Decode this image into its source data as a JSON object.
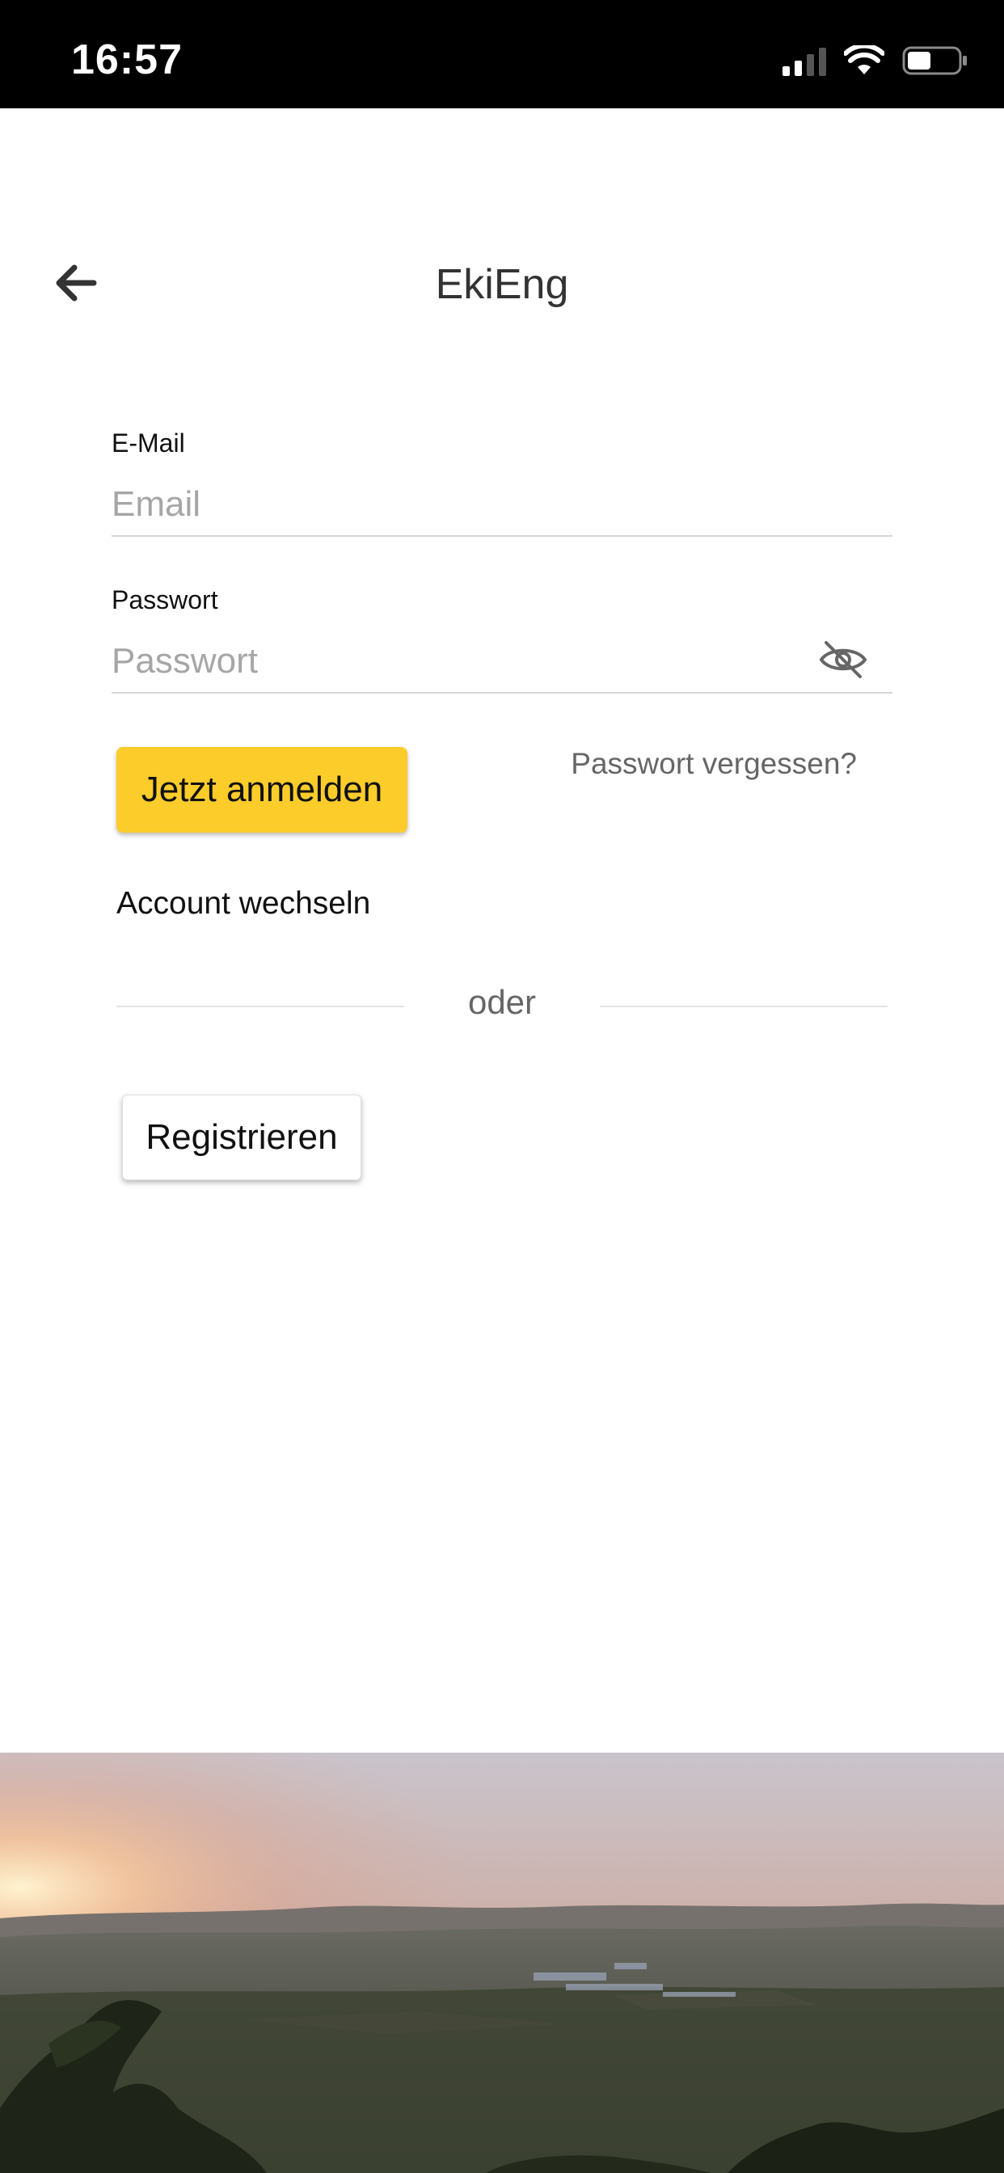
{
  "status_bar": {
    "time": "16:57",
    "icons": [
      "signal-icon",
      "wifi-icon",
      "battery-icon"
    ]
  },
  "header": {
    "title": "EkiEng",
    "back_icon": "arrow-left-icon"
  },
  "form": {
    "email": {
      "label": "E-Mail",
      "placeholder": "Email",
      "value": ""
    },
    "password": {
      "label": "Passwort",
      "placeholder": "Passwort",
      "value": "",
      "toggle_icon": "eye-off-icon"
    },
    "login_label": "Jetzt anmelden",
    "forgot_label": "Passwort vergessen?",
    "switch_account_label": "Account wechseln",
    "divider_label": "oder",
    "register_label": "Registrieren"
  },
  "colors": {
    "accent": "#fccc2b",
    "status_bar": "#000000",
    "background": "#ffffff"
  },
  "images": {
    "footer": "sunset-landscape-photo"
  }
}
